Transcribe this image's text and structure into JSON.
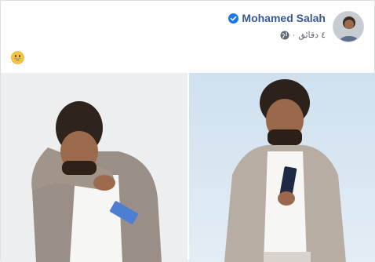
{
  "post": {
    "author": {
      "name": "Mohamed Salah",
      "verified": true
    },
    "timestamp": "٤ دقائق",
    "separator": "·",
    "privacy_icon": "globe-icon",
    "message_emoji": "😀"
  },
  "photos": [
    {
      "name": "photo-left",
      "description_icon": "person-with-phone-left"
    },
    {
      "name": "photo-right",
      "description_icon": "person-with-phone-right"
    }
  ],
  "colors": {
    "author": "#385898",
    "verified": "#1877f2",
    "meta": "#606770",
    "border": "#dddfe2"
  }
}
